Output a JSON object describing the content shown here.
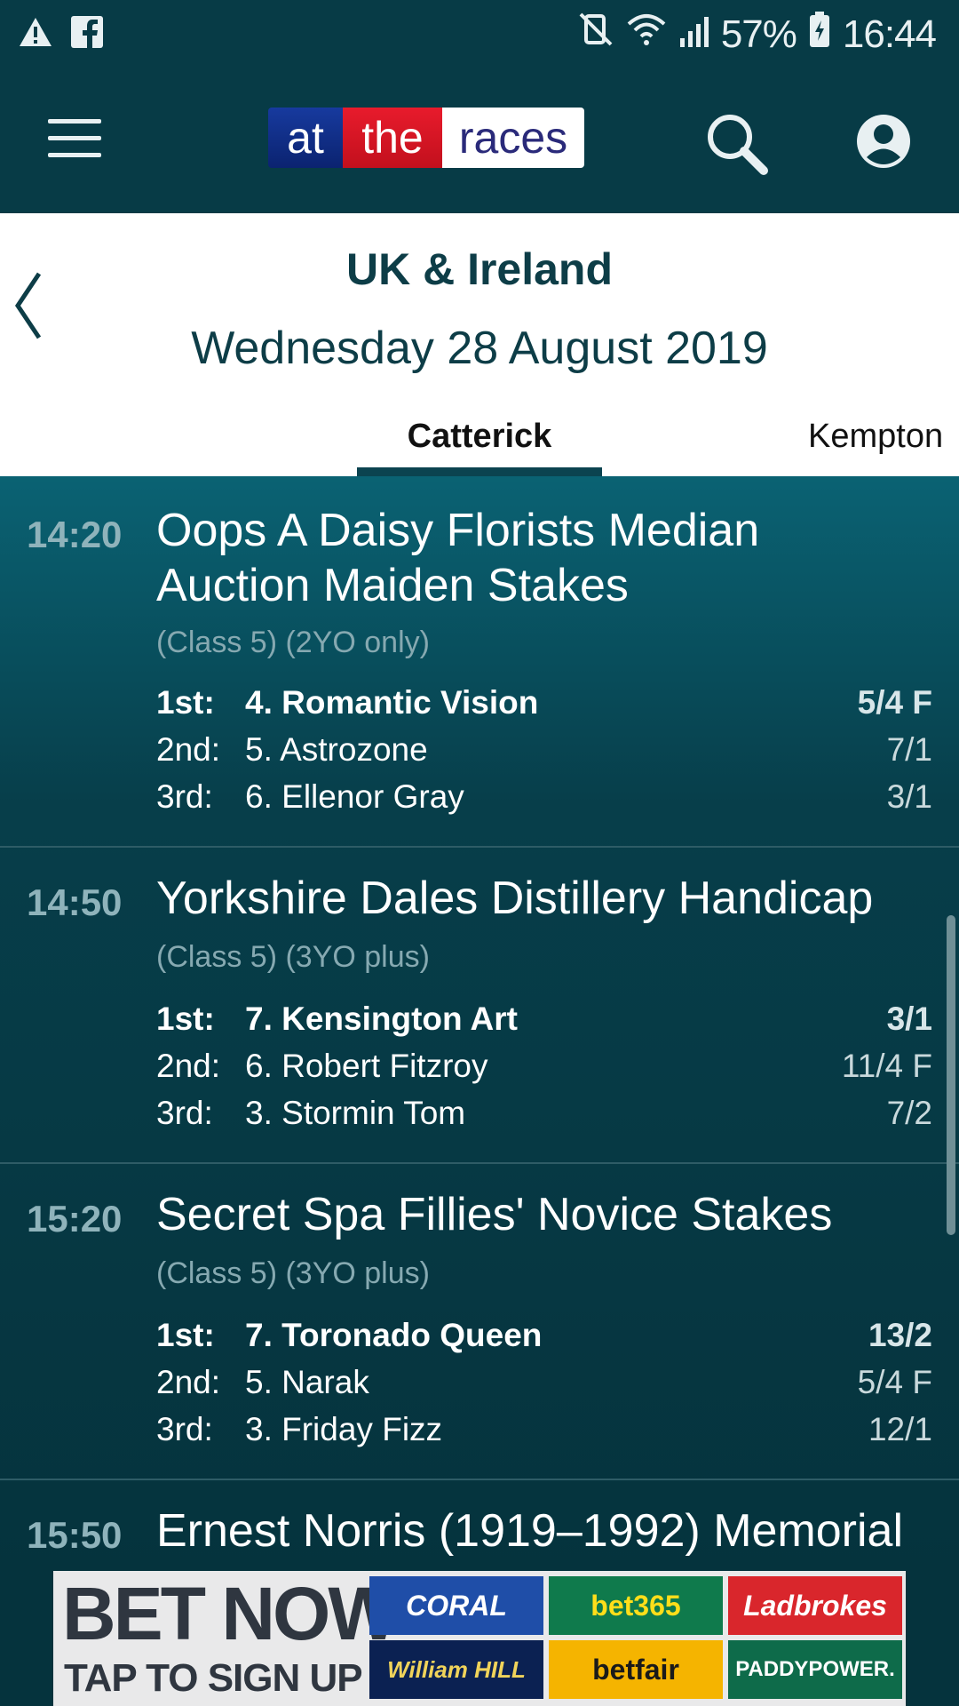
{
  "status_bar": {
    "battery": "57%",
    "time": "16:44",
    "icons": [
      "warning-icon",
      "facebook-icon",
      "mute-icon",
      "wifi-icon",
      "signal-icon",
      "battery-charging-icon"
    ]
  },
  "app_bar": {
    "logo": {
      "part1": "at",
      "part2": "the",
      "part3": "races"
    },
    "icons": [
      "menu-icon",
      "search-icon",
      "account-icon"
    ]
  },
  "header": {
    "region": "UK & Ireland",
    "date": "Wednesday 28 August 2019",
    "tabs": [
      {
        "label": "Catterick",
        "active": true
      },
      {
        "label": "Kempton",
        "active": false
      }
    ]
  },
  "races": [
    {
      "time": "14:20",
      "name_line1": "Oops A Daisy Florists Median",
      "name_line2": "Auction Maiden Stakes",
      "class": "(Class 5) (2YO only)",
      "placings": [
        {
          "pos": "1st:",
          "horse": "4. Romantic Vision",
          "odds": "5/4 F"
        },
        {
          "pos": "2nd:",
          "horse": "5. Astrozone",
          "odds": "7/1"
        },
        {
          "pos": "3rd:",
          "horse": "6. Ellenor Gray",
          "odds": "3/1"
        }
      ]
    },
    {
      "time": "14:50",
      "name_line1": "Yorkshire Dales Distillery Handicap",
      "class": "(Class 5) (3YO plus)",
      "placings": [
        {
          "pos": "1st:",
          "horse": "7. Kensington Art",
          "odds": "3/1"
        },
        {
          "pos": "2nd:",
          "horse": "6. Robert Fitzroy",
          "odds": "11/4 F"
        },
        {
          "pos": "3rd:",
          "horse": "3. Stormin Tom",
          "odds": "7/2"
        }
      ]
    },
    {
      "time": "15:20",
      "name_line1": "Secret Spa Fillies' Novice Stakes",
      "class": "(Class 5) (3YO plus)",
      "placings": [
        {
          "pos": "1st:",
          "horse": "7. Toronado Queen",
          "odds": "13/2"
        },
        {
          "pos": "2nd:",
          "horse": "5. Narak",
          "odds": "5/4 F"
        },
        {
          "pos": "3rd:",
          "horse": "3. Friday Fizz",
          "odds": "12/1"
        }
      ]
    },
    {
      "time": "15:50",
      "name_line1": "Ernest Norris (1919–1992) Memorial"
    }
  ],
  "ad": {
    "headline": "BET NOW",
    "subline": "TAP TO SIGN UP",
    "bookmakers": [
      "CORAL",
      "bet365",
      "Ladbrokes",
      "William HILL",
      "betfair",
      "PADDYPOWER."
    ],
    "colors": {
      "coral": "#1f4ea8",
      "bet365": "#0f7a4c",
      "ladbrokes": "#d9262c",
      "williamhill": "#0b2152",
      "betfair": "#f5b400",
      "paddypower": "#0e6b4a"
    }
  },
  "colors": {
    "dark_teal": "#073b46",
    "accent_teal": "#0a6273"
  }
}
